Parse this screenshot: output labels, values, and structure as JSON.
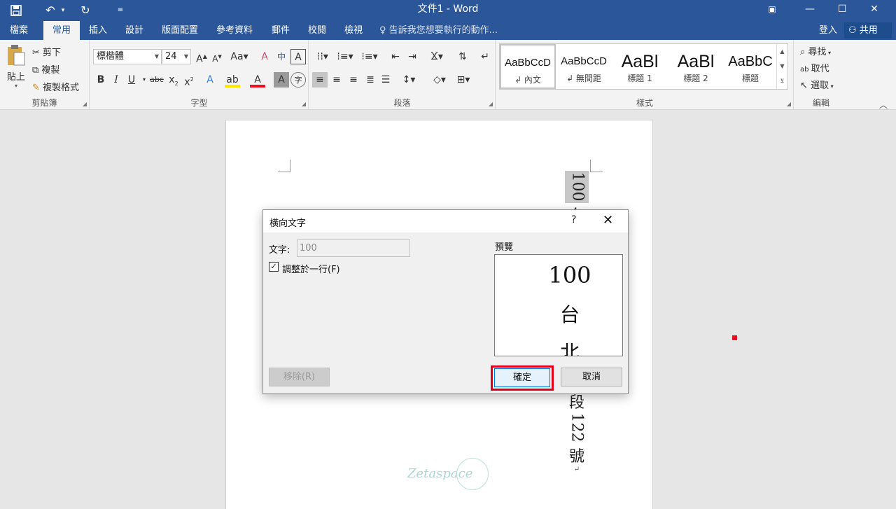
{
  "window": {
    "title": "文件1 - Word",
    "qat": {
      "save_icon": "save-icon",
      "undo_icon": "undo-icon",
      "redo_icon": "redo-icon",
      "customize_icon": "customize-icon"
    }
  },
  "tabs": [
    "檔案",
    "常用",
    "插入",
    "設計",
    "版面配置",
    "參考資料",
    "郵件",
    "校閱",
    "檢視"
  ],
  "active_tab": "常用",
  "tell_me": "告訴我您想要執行的動作...",
  "sign_in": "登入",
  "share": "共用",
  "clipboard": {
    "paste": "貼上",
    "cut": "剪下",
    "copy": "複製",
    "format_painter": "複製格式",
    "label": "剪貼簿"
  },
  "font": {
    "family": "標楷體",
    "size": "24",
    "label": "字型"
  },
  "paragraph": {
    "label": "段落"
  },
  "styles": {
    "items": [
      {
        "preview": "AaBbCcD",
        "name": "↲ 內文"
      },
      {
        "preview": "AaBbCcD",
        "name": "↲ 無間距"
      },
      {
        "preview": "AaBl",
        "name": "標題 1"
      },
      {
        "preview": "AaBl",
        "name": "標題 2"
      },
      {
        "preview": "AaBbC",
        "name": "標題"
      }
    ],
    "label": "樣式"
  },
  "editing": {
    "find": "尋找",
    "replace": "取代",
    "select": "選取",
    "label": "編輯"
  },
  "document": {
    "top_number": "100",
    "top_char": "台",
    "low_chars": [
      "段"
    ],
    "low_number": "122",
    "low_tail": "號",
    "watermark": "Zetaspace"
  },
  "dialog": {
    "title": "橫向文字",
    "help": "?",
    "text_label": "文字:",
    "text_value": "100",
    "fit_label": "調整於一行(F)",
    "fit_checked": "✓",
    "preview_label": "預覽",
    "preview_lines": [
      "100",
      "台",
      "北"
    ],
    "remove": "移除(R)",
    "ok": "確定",
    "cancel": "取消"
  }
}
